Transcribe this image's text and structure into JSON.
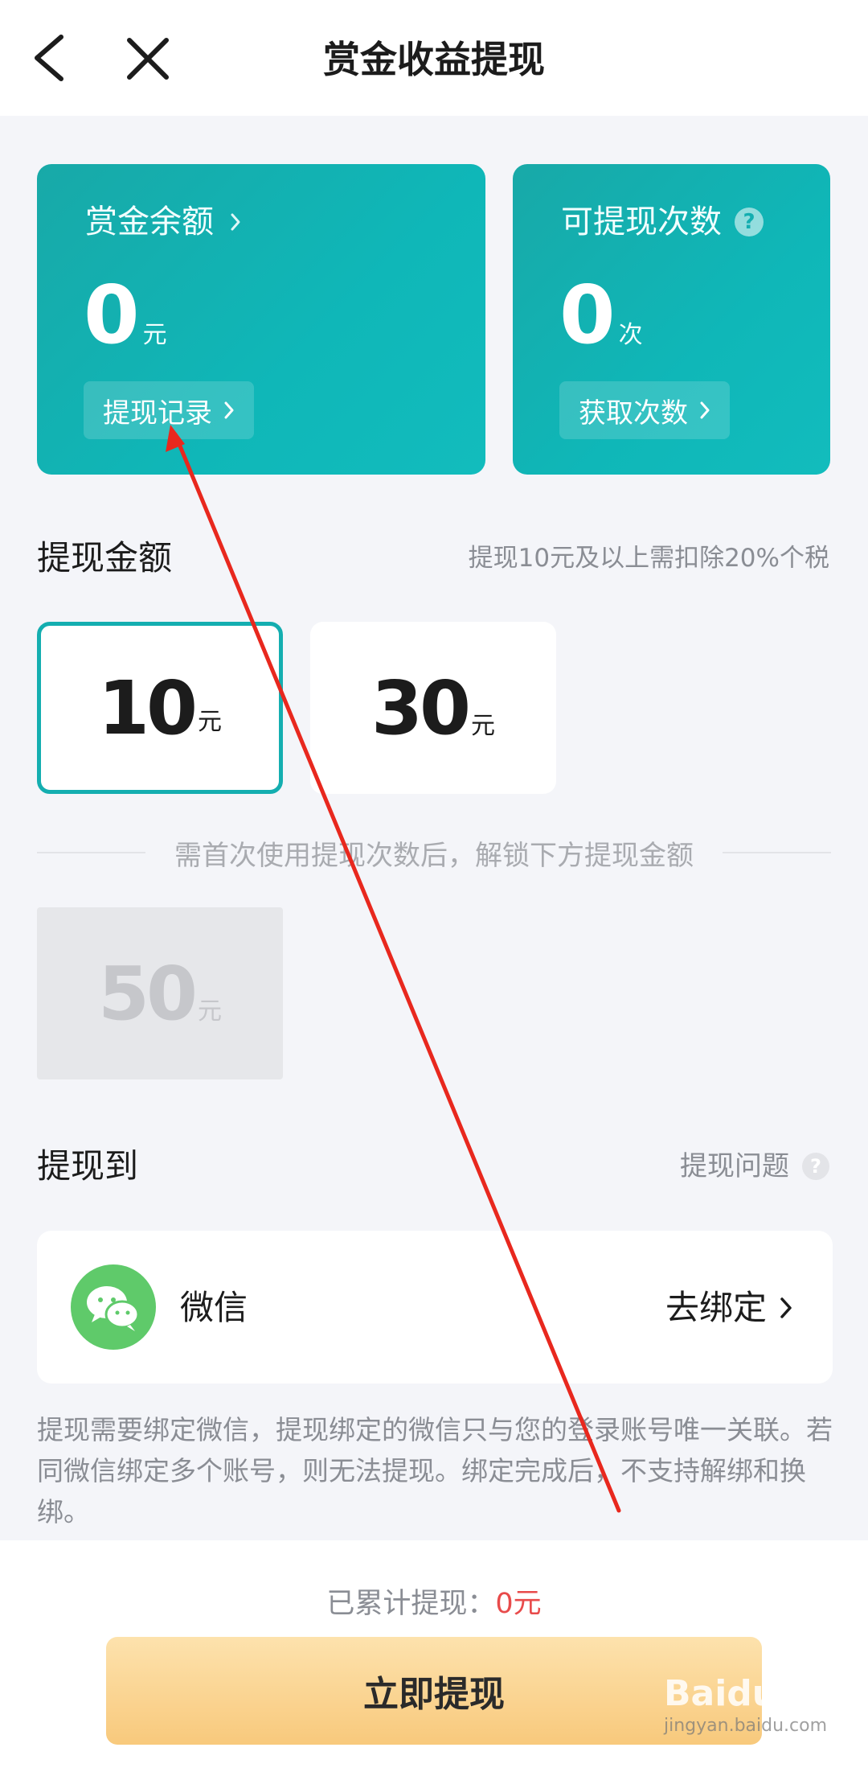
{
  "nav": {
    "title": "赏金收益提现"
  },
  "balance_card": {
    "label": "赏金余额",
    "value": "0",
    "unit": "元",
    "button": "提现记录"
  },
  "count_card": {
    "label": "可提现次数",
    "help_glyph": "?",
    "value": "0",
    "unit": "次",
    "button": "获取次数"
  },
  "amount_section": {
    "title": "提现金额",
    "note": "提现10元及以上需扣除20%个税",
    "options": [
      {
        "value": "10",
        "unit": "元",
        "state": "selected"
      },
      {
        "value": "30",
        "unit": "元",
        "state": "available"
      }
    ],
    "divider_text": "需首次使用提现次数后，解锁下方提现金额",
    "locked_option": {
      "value": "50",
      "unit": "元",
      "state": "locked"
    }
  },
  "destination": {
    "title": "提现到",
    "help_link": "提现问题",
    "help_glyph": "?",
    "channel_name": "微信",
    "channel_action": "去绑定"
  },
  "info_text": "提现需要绑定微信，提现绑定的微信只与您的登录账号唯一关联。若同微信绑定多个账号，则无法提现。绑定完成后，不支持解绑和换绑。",
  "footer": {
    "total_label": "已累计提现：",
    "total_value": "0元",
    "submit_label": "立即提现"
  },
  "watermark": {
    "brand": "Baidu经验",
    "url": "jingyan.baidu.com"
  },
  "colors": {
    "teal": "#14aeb0",
    "red": "#e84b4b",
    "wechat_green": "#5fca6a",
    "button_gold": "#f8c97c",
    "arrow": "#e8281e"
  }
}
